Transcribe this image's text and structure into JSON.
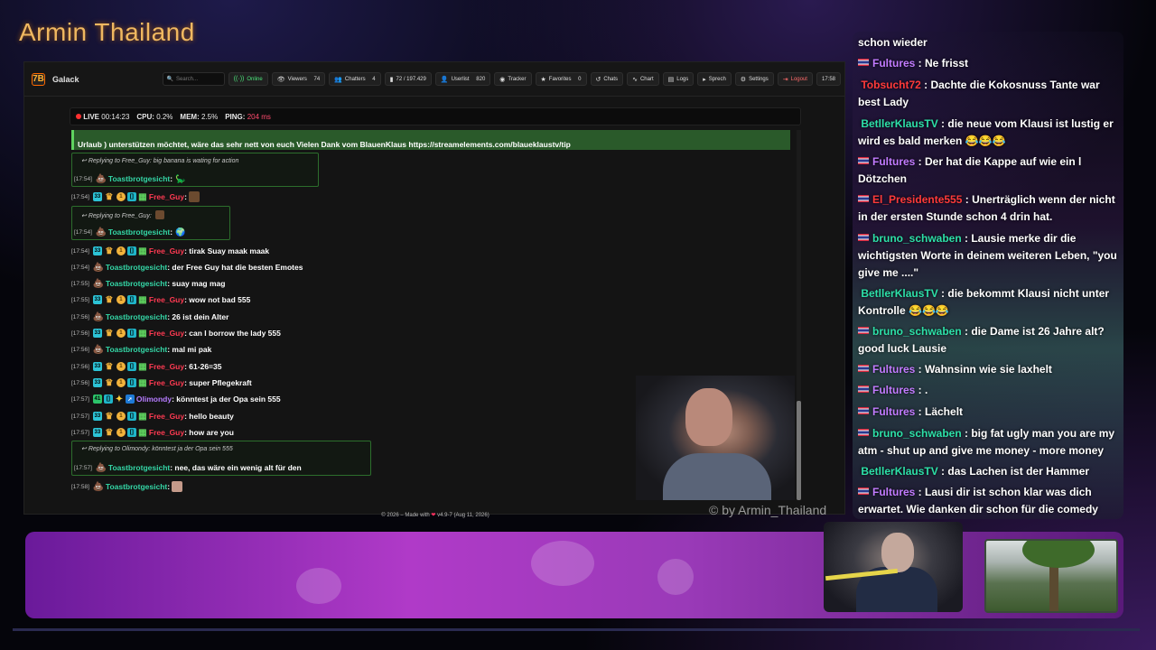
{
  "stream": {
    "title": "Armin Thailand",
    "watermark": "© by Armin_Thailand"
  },
  "app": {
    "logo": "7B",
    "name": "Galack",
    "search_placeholder": "Search...",
    "toolbar": {
      "online": "Online",
      "viewers": "Viewers",
      "viewers_count": "74",
      "chatters": "Chatters",
      "chatters_count": "4",
      "msgs": "72 / 197.429",
      "userlist": "Userlist",
      "userlist_count": "820",
      "tracker": "Tracker",
      "favorites": "Favorites",
      "favorites_count": "0",
      "chats": "Chats",
      "chart": "Chart",
      "logs": "Logs",
      "sprech": "Sprech",
      "settings": "Settings",
      "logout": "Logout",
      "time": "17:58"
    },
    "status": {
      "live": "LIVE",
      "uptime": "00:14:23",
      "cpu_label": "CPU:",
      "cpu": "0.2%",
      "mem_label": "MEM:",
      "mem": "2.5%",
      "ping_label": "PING:",
      "ping": "204 ms"
    },
    "announcement": {
      "line1": "Urlaub ) unterstützen möchtet, wäre das sehr nett von euch Vielen Dank vom BlauenKlaus https://streamelements.com/blaueklaustv/tip"
    },
    "messages": [
      {
        "reply": "Replying to Free_Guy: big banana is wating for action",
        "ts": "[17:54]",
        "user": "Toastbrotgesicht",
        "text": ":",
        "emote": "🦕"
      },
      {
        "ts": "[17:54]",
        "user": "Free_Guy",
        "text": ":"
      },
      {
        "reply": "Replying to Free_Guy:",
        "ts": "[17:54]",
        "user": "Toastbrotgesicht",
        "text": ":",
        "emote": "🌍"
      },
      {
        "ts": "[17:54]",
        "user": "Free_Guy",
        "text": ": tirak Suay maak maak"
      },
      {
        "ts": "[17:54]",
        "user": "Toastbrotgesicht",
        "text": ": der Free Guy hat die besten Emotes"
      },
      {
        "ts": "[17:55]",
        "user": "Toastbrotgesicht",
        "text": ": suay mag mag"
      },
      {
        "ts": "[17:55]",
        "user": "Free_Guy",
        "text": ": wow not bad 555"
      },
      {
        "ts": "[17:56]",
        "user": "Toastbrotgesicht",
        "text": ": 26 ist dein Alter"
      },
      {
        "ts": "[17:56]",
        "user": "Free_Guy",
        "text": ": can I borrow the lady 555"
      },
      {
        "ts": "[17:56]",
        "user": "Toastbrotgesicht",
        "text": ": mal mi pak"
      },
      {
        "ts": "[17:56]",
        "user": "Free_Guy",
        "text": ": 61-26=35"
      },
      {
        "ts": "[17:56]",
        "user": "Free_Guy",
        "text": ": super Pflegekraft"
      },
      {
        "ts": "[17:57]",
        "user": "Olimondy",
        "text": ": könntest ja der Opa sein 555",
        "badge_count": "41"
      },
      {
        "ts": "[17:57]",
        "user": "Free_Guy",
        "text": ": hello beauty"
      },
      {
        "ts": "[17:57]",
        "user": "Free_Guy",
        "text": ": how are you"
      },
      {
        "reply": "Replying to Olimondy: könntest ja der Opa sein 555",
        "ts": "[17:57]",
        "user": "Toastbrotgesicht",
        "text": ": nee, das wäre ein wenig alt für den"
      },
      {
        "ts": "[17:58]",
        "user": "Toastbrotgesicht",
        "text": ":"
      }
    ],
    "badges": {
      "sub": "33",
      "coin": "1",
      "bits": "[]"
    },
    "footer": {
      "prefix": "© 2026 – Made with",
      "heart": "❤",
      "suffix": "v4.9-7 (Aug 11, 2026)"
    }
  },
  "overlay_chat": [
    {
      "user": "",
      "text": "schon wieder",
      "color": "none"
    },
    {
      "user": "Fultures",
      "text": " : Ne frisst",
      "color": "purple",
      "flag": true
    },
    {
      "user": "Tobsucht72",
      "text": " : Dachte die Kokosnuss Tante war best Lady",
      "color": "red"
    },
    {
      "user": "BetllerKlausTV",
      "text": " : die neue vom Klausi ist lustig er wird es bald merken 😂😂😂",
      "color": "green"
    },
    {
      "user": "Fultures",
      "text": " : Der hat die Kappe auf wie ein l Dötzchen",
      "color": "purple",
      "flag": true
    },
    {
      "user": "El_Presidente555",
      "text": " : Unerträglich wenn der nicht in der ersten Stunde schon 4 drin hat.",
      "color": "red",
      "flag": true
    },
    {
      "user": "bruno_schwaben",
      "text": " : Lausie merke dir die wichtigsten Worte in deinem weiteren Leben, \"you give me ....\"",
      "color": "green",
      "flag": true
    },
    {
      "user": "BetllerKlausTV",
      "text": " : die bekommt Klausi nicht unter Kontrolle 😂😂😂",
      "color": "green"
    },
    {
      "user": "bruno_schwaben",
      "text": " : die Dame ist 26 Jahre alt? good luck Lausie",
      "color": "green",
      "flag": true
    },
    {
      "user": "Fultures",
      "text": " : Wahnsinn wie sie laxhelt",
      "color": "purple",
      "flag": true
    },
    {
      "user": "Fultures",
      "text": " : .",
      "color": "purple",
      "flag": true
    },
    {
      "user": "Fultures",
      "text": " : Lächelt",
      "color": "purple",
      "flag": true
    },
    {
      "user": "bruno_schwaben",
      "text": " : big fat ugly man you are my atm - shut up and give me money - more money",
      "color": "green",
      "flag": true
    },
    {
      "user": "BetllerKlausTV",
      "text": " : das Lachen ist der Hammer",
      "color": "green"
    },
    {
      "user": "Fultures",
      "text": " : Lausi dir ist schon klar was dich erwartet. Wie danken dir schon für die comedy",
      "color": "purple",
      "flag": true
    }
  ]
}
